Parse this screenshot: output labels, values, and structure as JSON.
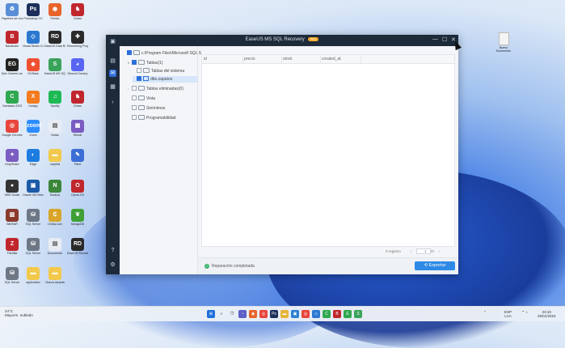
{
  "desktop": {
    "icons": [
      {
        "label": "Papelera de reciclaje",
        "icon": "recycle-bin-icon",
        "color": "#5a8fd6",
        "glyph": "♻"
      },
      {
        "label": "Photoshop CC",
        "icon": "photoshop-icon",
        "color": "#1b2f5a",
        "glyph": "Ps"
      },
      {
        "label": "Firefox",
        "icon": "firefox-icon",
        "color": "#e8642a",
        "glyph": "◉"
      },
      {
        "label": "Chess",
        "icon": "chess-icon",
        "color": "#c0272d",
        "glyph": "♞"
      },
      {
        "label": "Bandicam",
        "icon": "bandicam-icon",
        "color": "#c0272d",
        "glyph": "B"
      },
      {
        "label": "Visual Studio Code",
        "icon": "vscode-icon",
        "color": "#2b78d0",
        "glyph": "◇"
      },
      {
        "label": "EaseUS Data Recovery",
        "icon": "easeus-recovery-icon",
        "color": "#2a2a2a",
        "glyph": "RD"
      },
      {
        "label": "Recovering Program",
        "icon": "recovery-program-icon",
        "color": "#2a2a2a",
        "glyph": "✚"
      },
      {
        "label": "Epic Games Launcher",
        "icon": "epic-games-icon",
        "color": "#222",
        "glyph": "EG"
      },
      {
        "label": "Git Bash",
        "icon": "git-bash-icon",
        "color": "#f05032",
        "glyph": "◆"
      },
      {
        "label": "EaseUS MS SQL Recovery",
        "icon": "sql-recovery-icon",
        "color": "#3aa35b",
        "glyph": "S"
      },
      {
        "label": "Discord Canary",
        "icon": "discord-icon",
        "color": "#5865f2",
        "glyph": "◕"
      },
      {
        "label": "Camtasia 2023",
        "icon": "camtasia-icon",
        "color": "#2fa84f",
        "glyph": "C"
      },
      {
        "label": "Xampp",
        "icon": "xampp-icon",
        "color": "#f47b20",
        "glyph": "X"
      },
      {
        "label": "Spotify",
        "icon": "spotify-icon",
        "color": "#1db954",
        "glyph": "♫"
      },
      {
        "label": "Chess",
        "icon": "chess-icon-2",
        "color": "#c0272d",
        "glyph": "♞"
      },
      {
        "label": "Google Chrome",
        "icon": "chrome-icon",
        "color": "#e8453c",
        "glyph": "◎"
      },
      {
        "label": "Zoom",
        "icon": "zoom-icon",
        "color": "#2d8cff",
        "glyph": "zoom"
      },
      {
        "label": "Notas",
        "icon": "document-icon",
        "color": "#e9edf3",
        "glyph": "▤"
      },
      {
        "label": "Winrar",
        "icon": "winrar-icon",
        "color": "#7a5cc2",
        "glyph": "▦"
      },
      {
        "label": "DropShare",
        "icon": "dropshare-icon",
        "color": "#7a5cc2",
        "glyph": "✦"
      },
      {
        "label": "Edge",
        "icon": "edge-icon",
        "color": "#1d7ce0",
        "glyph": "◐"
      },
      {
        "label": "carpeta",
        "icon": "folder-icon",
        "color": "#f2c94c",
        "glyph": "▬"
      },
      {
        "label": "Paint",
        "icon": "paint-icon",
        "color": "#3b6fd6",
        "glyph": "✎"
      },
      {
        "label": "OBS Studio",
        "icon": "obs-icon",
        "color": "#333",
        "glyph": "●"
      },
      {
        "label": "Oracle VM VirtualBox",
        "icon": "virtualbox-icon",
        "color": "#1e5aa8",
        "glyph": "▣"
      },
      {
        "label": "Node.js",
        "icon": "nodejs-icon",
        "color": "#3c873a",
        "glyph": "N"
      },
      {
        "label": "Opera GX",
        "icon": "opera-icon",
        "color": "#c0272d",
        "glyph": "O"
      },
      {
        "label": "WinRAR",
        "icon": "winrar-icon-2",
        "color": "#8a3b2e",
        "glyph": "▥"
      },
      {
        "label": "SQL Server",
        "icon": "sql-server-icon",
        "color": "#6d7785",
        "glyph": "⛁"
      },
      {
        "label": "Chess.com",
        "icon": "chesscom-icon",
        "color": "#d8a52a",
        "glyph": "₵"
      },
      {
        "label": "MongoDB",
        "icon": "mongodb-icon",
        "color": "#3fa037",
        "glyph": "❦"
      },
      {
        "label": "FileZilla",
        "icon": "filezilla-icon",
        "color": "#c0272d",
        "glyph": "Z"
      },
      {
        "label": "SQL Server",
        "icon": "sql-server-icon-2",
        "color": "#6d7785",
        "glyph": "⛁"
      },
      {
        "label": "Documento",
        "icon": "document-icon-2",
        "color": "#e9edf3",
        "glyph": "▤"
      },
      {
        "label": "EaseUS Recovery",
        "icon": "easeus-icon-2",
        "color": "#2a2a2a",
        "glyph": "RD"
      },
      {
        "label": "SQL Server",
        "icon": "sql-server-icon-3",
        "color": "#6d7785",
        "glyph": "⛁"
      },
      {
        "label": "application",
        "icon": "folder-icon-2",
        "color": "#f2c94c",
        "glyph": "▬"
      },
      {
        "label": "Nueva carpeta",
        "icon": "folder-icon-3",
        "color": "#f2c94c",
        "glyph": "▬"
      }
    ],
    "file_icon": {
      "label": "Nuevo Documento"
    }
  },
  "window": {
    "title": "EaseUS MS SQL Recovery",
    "badge": "Pro",
    "controls": {
      "minimize": "—",
      "maximize": "☐",
      "close": "✕"
    },
    "rail_icons": [
      "▣",
      "▤",
      "✉",
      "▦",
      "›",
      "?",
      "⚙"
    ],
    "tree": [
      {
        "label": "c:\\Program Files\\Microsoft SQL S",
        "level": 0,
        "checked": true,
        "arrow": "",
        "kind": "root"
      },
      {
        "label": "Tablas(1)",
        "level": 1,
        "checked": true,
        "arrow": "▾",
        "kind": "folder"
      },
      {
        "label": "Tablas del sistema",
        "level": 2,
        "checked": false,
        "arrow": "",
        "kind": "folder"
      },
      {
        "label": "dbo.zapatos",
        "level": 2,
        "checked": true,
        "arrow": "",
        "kind": "table",
        "selected": true
      },
      {
        "label": "Tablas eliminadas(0)",
        "level": 1,
        "checked": false,
        "arrow": "›",
        "kind": "folder"
      },
      {
        "label": "Vista",
        "level": 1,
        "checked": false,
        "arrow": "",
        "kind": "folder"
      },
      {
        "label": "Sinónimos",
        "level": 1,
        "checked": false,
        "arrow": "",
        "kind": "folder"
      },
      {
        "label": "Programabilidad",
        "level": 1,
        "checked": false,
        "arrow": "",
        "kind": "folder"
      }
    ],
    "columns": [
      "id",
      "precio",
      "stock",
      "created_at"
    ],
    "pager": {
      "count": "0 registro",
      "prev": "‹",
      "page": "1",
      "total": "/0",
      "next": "›"
    },
    "status": {
      "message": "Reparación completada"
    },
    "export_label": "Exportar"
  },
  "taskbar": {
    "weather": {
      "temp": "24°C",
      "desc": "Mayorm. nublado"
    },
    "apps": [
      {
        "name": "start-icon",
        "glyph": "⊞",
        "color": "#1e6fd9"
      },
      {
        "name": "search-icon",
        "glyph": "⌕",
        "color": "#555"
      },
      {
        "name": "task-view-icon",
        "glyph": "❐",
        "color": "#555"
      },
      {
        "name": "chat-icon",
        "glyph": "◔",
        "color": "#5b5fc7"
      },
      {
        "name": "firefox-icon",
        "glyph": "◉",
        "color": "#e8642a"
      },
      {
        "name": "chrome-icon",
        "glyph": "◎",
        "color": "#e8453c"
      },
      {
        "name": "photoshop-icon",
        "glyph": "Ps",
        "color": "#1b2f5a"
      },
      {
        "name": "explorer-icon",
        "glyph": "▬",
        "color": "#e6b43b"
      },
      {
        "name": "store-icon",
        "glyph": "▣",
        "color": "#2d7fd3"
      },
      {
        "name": "chrome-icon-2",
        "glyph": "◎",
        "color": "#e8453c"
      },
      {
        "name": "vscode-icon",
        "glyph": "◇",
        "color": "#2b78d0"
      },
      {
        "name": "camtasia-icon",
        "glyph": "C",
        "color": "#2fa84f"
      },
      {
        "name": "bandicam-icon",
        "glyph": "B",
        "color": "#c0272d"
      },
      {
        "name": "easeus-icon",
        "glyph": "E",
        "color": "#2fa84f"
      },
      {
        "name": "sql-recovery-icon",
        "glyph": "S",
        "color": "#3aa35b"
      }
    ],
    "tray": {
      "lang": "ESP",
      "layout": "LAA",
      "time": "23:10",
      "date": "25/01/2024"
    }
  }
}
